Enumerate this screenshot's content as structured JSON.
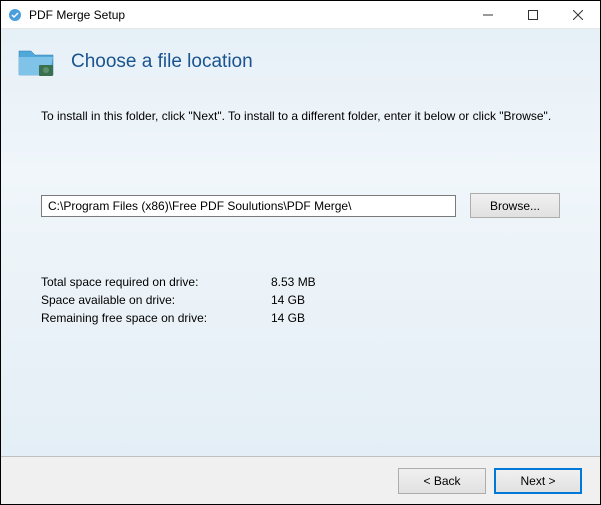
{
  "titlebar": {
    "title": "PDF Merge Setup"
  },
  "header": {
    "title": "Choose a file location"
  },
  "instruction": "To install in this folder, click \"Next\". To install to a different folder, enter it below or click \"Browse\".",
  "path": {
    "value": "C:\\Program Files (x86)\\Free PDF Soulutions\\PDF Merge\\"
  },
  "browse_label": "Browse...",
  "space": {
    "required_label": "Total space required on drive:",
    "required_value": "8.53 MB",
    "available_label": "Space available on drive:",
    "available_value": "14 GB",
    "remaining_label": "Remaining free space on drive:",
    "remaining_value": "14 GB"
  },
  "footer": {
    "back_label": "< Back",
    "next_label": "Next >"
  }
}
